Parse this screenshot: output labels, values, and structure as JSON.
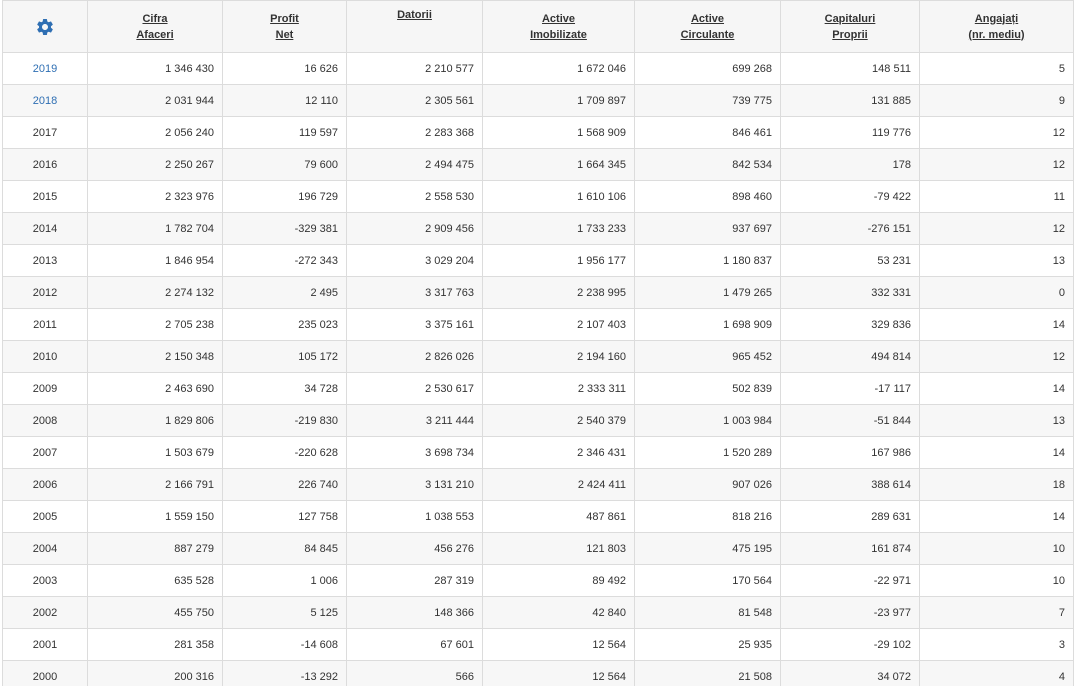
{
  "colors": {
    "accent": "#2f6fb3",
    "header_bg": "#f6f6f6",
    "row_alt": "#f7f7f7",
    "border": "#dcdcdc"
  },
  "header": {
    "settings_icon": "gear-icon",
    "columns": [
      {
        "line1": "Cifra",
        "line2": "Afaceri"
      },
      {
        "line1": "Profit",
        "line2": "Net"
      },
      {
        "line1": "Datorii",
        "line2": ""
      },
      {
        "line1": "Active",
        "line2": "Imobilizate"
      },
      {
        "line1": "Active",
        "line2": "Circulante"
      },
      {
        "line1": "Capitaluri",
        "line2": "Proprii"
      },
      {
        "line1": "Angajați",
        "line2": "(nr. mediu)"
      }
    ]
  },
  "rows": [
    {
      "year": "2019",
      "link": true,
      "cifra": "1 346 430",
      "profit": "16 626",
      "datorii": "2 210 577",
      "imob": "1 672 046",
      "circ": "699 268",
      "cap": "148 511",
      "ang": "5"
    },
    {
      "year": "2018",
      "link": true,
      "cifra": "2 031 944",
      "profit": "12 110",
      "datorii": "2 305 561",
      "imob": "1 709 897",
      "circ": "739 775",
      "cap": "131 885",
      "ang": "9"
    },
    {
      "year": "2017",
      "link": false,
      "cifra": "2 056 240",
      "profit": "119 597",
      "datorii": "2 283 368",
      "imob": "1 568 909",
      "circ": "846 461",
      "cap": "119 776",
      "ang": "12"
    },
    {
      "year": "2016",
      "link": false,
      "cifra": "2 250 267",
      "profit": "79 600",
      "datorii": "2 494 475",
      "imob": "1 664 345",
      "circ": "842 534",
      "cap": "178",
      "ang": "12"
    },
    {
      "year": "2015",
      "link": false,
      "cifra": "2 323 976",
      "profit": "196 729",
      "datorii": "2 558 530",
      "imob": "1 610 106",
      "circ": "898 460",
      "cap": "-79 422",
      "ang": "11"
    },
    {
      "year": "2014",
      "link": false,
      "cifra": "1 782 704",
      "profit": "-329 381",
      "datorii": "2 909 456",
      "imob": "1 733 233",
      "circ": "937 697",
      "cap": "-276 151",
      "ang": "12"
    },
    {
      "year": "2013",
      "link": false,
      "cifra": "1 846 954",
      "profit": "-272 343",
      "datorii": "3 029 204",
      "imob": "1 956 177",
      "circ": "1 180 837",
      "cap": "53 231",
      "ang": "13"
    },
    {
      "year": "2012",
      "link": false,
      "cifra": "2 274 132",
      "profit": "2 495",
      "datorii": "3 317 763",
      "imob": "2 238 995",
      "circ": "1 479 265",
      "cap": "332 331",
      "ang": "0"
    },
    {
      "year": "2011",
      "link": false,
      "cifra": "2 705 238",
      "profit": "235 023",
      "datorii": "3 375 161",
      "imob": "2 107 403",
      "circ": "1 698 909",
      "cap": "329 836",
      "ang": "14"
    },
    {
      "year": "2010",
      "link": false,
      "cifra": "2 150 348",
      "profit": "105 172",
      "datorii": "2 826 026",
      "imob": "2 194 160",
      "circ": "965 452",
      "cap": "494 814",
      "ang": "12"
    },
    {
      "year": "2009",
      "link": false,
      "cifra": "2 463 690",
      "profit": "34 728",
      "datorii": "2 530 617",
      "imob": "2 333 311",
      "circ": "502 839",
      "cap": "-17 117",
      "ang": "14"
    },
    {
      "year": "2008",
      "link": false,
      "cifra": "1 829 806",
      "profit": "-219 830",
      "datorii": "3 211 444",
      "imob": "2 540 379",
      "circ": "1 003 984",
      "cap": "-51 844",
      "ang": "13"
    },
    {
      "year": "2007",
      "link": false,
      "cifra": "1 503 679",
      "profit": "-220 628",
      "datorii": "3 698 734",
      "imob": "2 346 431",
      "circ": "1 520 289",
      "cap": "167 986",
      "ang": "14"
    },
    {
      "year": "2006",
      "link": false,
      "cifra": "2 166 791",
      "profit": "226 740",
      "datorii": "3 131 210",
      "imob": "2 424 411",
      "circ": "907 026",
      "cap": "388 614",
      "ang": "18"
    },
    {
      "year": "2005",
      "link": false,
      "cifra": "1 559 150",
      "profit": "127 758",
      "datorii": "1 038 553",
      "imob": "487 861",
      "circ": "818 216",
      "cap": "289 631",
      "ang": "14"
    },
    {
      "year": "2004",
      "link": false,
      "cifra": "887 279",
      "profit": "84 845",
      "datorii": "456 276",
      "imob": "121 803",
      "circ": "475 195",
      "cap": "161 874",
      "ang": "10"
    },
    {
      "year": "2003",
      "link": false,
      "cifra": "635 528",
      "profit": "1 006",
      "datorii": "287 319",
      "imob": "89 492",
      "circ": "170 564",
      "cap": "-22 971",
      "ang": "10"
    },
    {
      "year": "2002",
      "link": false,
      "cifra": "455 750",
      "profit": "5 125",
      "datorii": "148 366",
      "imob": "42 840",
      "circ": "81 548",
      "cap": "-23 977",
      "ang": "7"
    },
    {
      "year": "2001",
      "link": false,
      "cifra": "281 358",
      "profit": "-14 608",
      "datorii": "67 601",
      "imob": "12 564",
      "circ": "25 935",
      "cap": "-29 102",
      "ang": "3"
    },
    {
      "year": "2000",
      "link": false,
      "cifra": "200 316",
      "profit": "-13 292",
      "datorii": "566",
      "imob": "12 564",
      "circ": "21 508",
      "cap": "34 072",
      "ang": "4"
    }
  ]
}
